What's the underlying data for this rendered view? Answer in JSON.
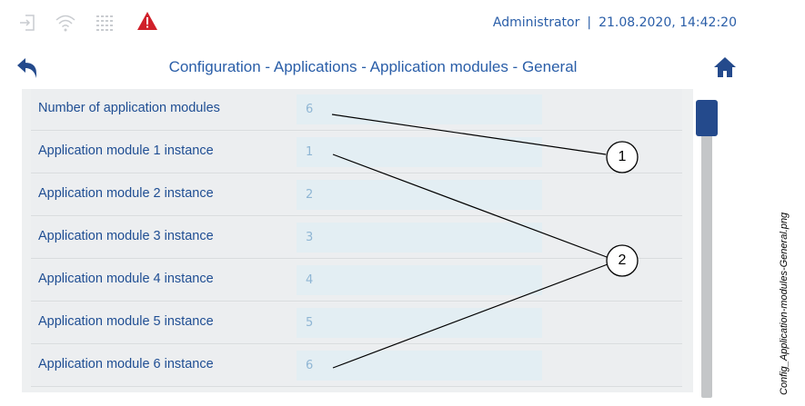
{
  "status_bar": {
    "icons": [
      "login-icon",
      "wifi-icon",
      "network-grid-icon",
      "warning-icon"
    ],
    "user": "Administrator",
    "separator": "|",
    "datetime": "21.08.2020, 14:42:20"
  },
  "title_bar": {
    "title": "Configuration - Applications - Application modules - General",
    "back_icon": "back-arrow-icon",
    "home_icon": "home-icon"
  },
  "rows": [
    {
      "label": "Number of application modules",
      "value": "6"
    },
    {
      "label": "Application module 1 instance",
      "value": "1"
    },
    {
      "label": "Application module 2 instance",
      "value": "2"
    },
    {
      "label": "Application module 3 instance",
      "value": "3"
    },
    {
      "label": "Application module 4 instance",
      "value": "4"
    },
    {
      "label": "Application module 5 instance",
      "value": "5"
    },
    {
      "label": "Application module 6 instance",
      "value": "6"
    }
  ],
  "callouts": [
    {
      "number": "1"
    },
    {
      "number": "2"
    }
  ],
  "side_caption": "Config_Application-modules-General.png",
  "colors": {
    "accent": "#2a5ea8",
    "warning": "#d0202a",
    "scroll_thumb": "#244a8c"
  }
}
